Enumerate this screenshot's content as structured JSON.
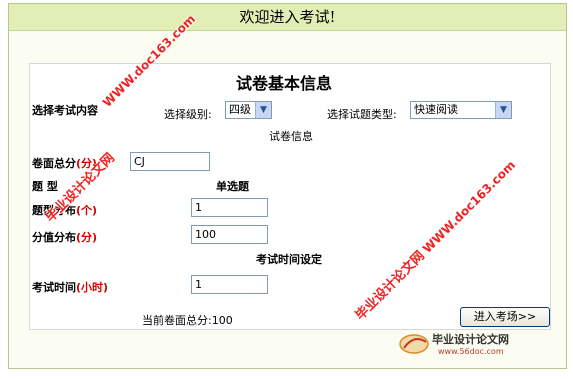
{
  "header": {
    "title": "欢迎进入考试!"
  },
  "form": {
    "title": "试卷基本信息",
    "select_content_label": "选择考试内容",
    "level_label": "选择级别:",
    "level_value": "四级",
    "question_type_label": "选择试题类型:",
    "question_type_value": "快速阅读",
    "paper_info_label": "试卷信息",
    "total_score_label": "卷面总分",
    "total_score_unit": "(分)",
    "total_score_value": "CJ",
    "question_type_row_label": "题  型",
    "question_type_row_value": "单选题",
    "question_dist_label": "题型分布",
    "question_dist_unit": "(个)",
    "question_dist_value": "1",
    "score_dist_label": "分值分布",
    "score_dist_unit": "(分)",
    "score_dist_value": "100",
    "time_settings_label": "考试时间设定",
    "exam_time_label": "考试时间",
    "exam_time_unit": "(小时)",
    "exam_time_value": "1",
    "current_total": "当前卷面总分:100",
    "enter_button": "进入考场>>"
  },
  "watermarks": {
    "url": "WWW.doc163.com",
    "site_name": "毕业设计论文网",
    "logo_text": "毕业设计论文网",
    "logo_url": "www.56doc.com"
  },
  "colors": {
    "banner": "#e3eeb7",
    "accent_red": "#d40000",
    "watermark": "#ee1111"
  }
}
